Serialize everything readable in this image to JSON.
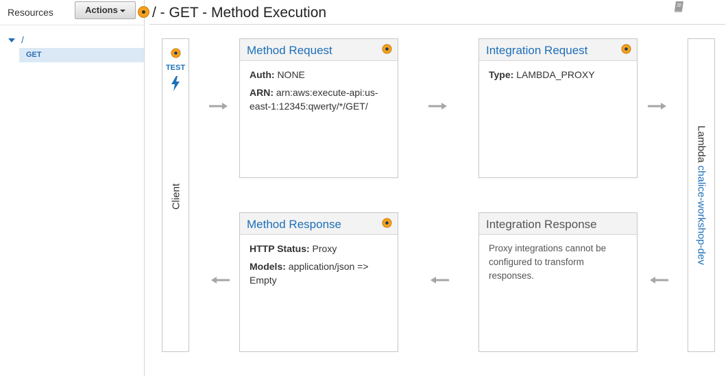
{
  "sidebar": {
    "resources_label": "Resources",
    "actions_label": "Actions",
    "tree_root": "/",
    "tree_child": "GET"
  },
  "header": {
    "title": "/ - GET - Method Execution"
  },
  "client": {
    "test_label": "TEST",
    "label": "Client"
  },
  "lambda": {
    "word": "Lambda",
    "function_name": "chalice-workshop-dev"
  },
  "method_request": {
    "title": "Method Request",
    "auth_key": "Auth:",
    "auth_value": "NONE",
    "arn_key": "ARN:",
    "arn_value": "arn:aws:execute-api:us-east-1:12345:qwerty/*/GET/"
  },
  "integration_request": {
    "title": "Integration Request",
    "type_key": "Type:",
    "type_value": "LAMBDA_PROXY"
  },
  "method_response": {
    "title": "Method Response",
    "status_key": "HTTP Status:",
    "status_value": "Proxy",
    "models_key": "Models:",
    "models_value": "application/json => Empty"
  },
  "integration_response": {
    "title": "Integration Response",
    "note": "Proxy integrations cannot be configured to transform responses."
  },
  "icons": {
    "spinner": "status-spinner-icon",
    "bolt": "lightning-bolt-icon",
    "book": "book-icon",
    "arrow": "arrow-icon"
  },
  "colors": {
    "link": "#1d6fb8",
    "accent": "#f5a11c"
  }
}
